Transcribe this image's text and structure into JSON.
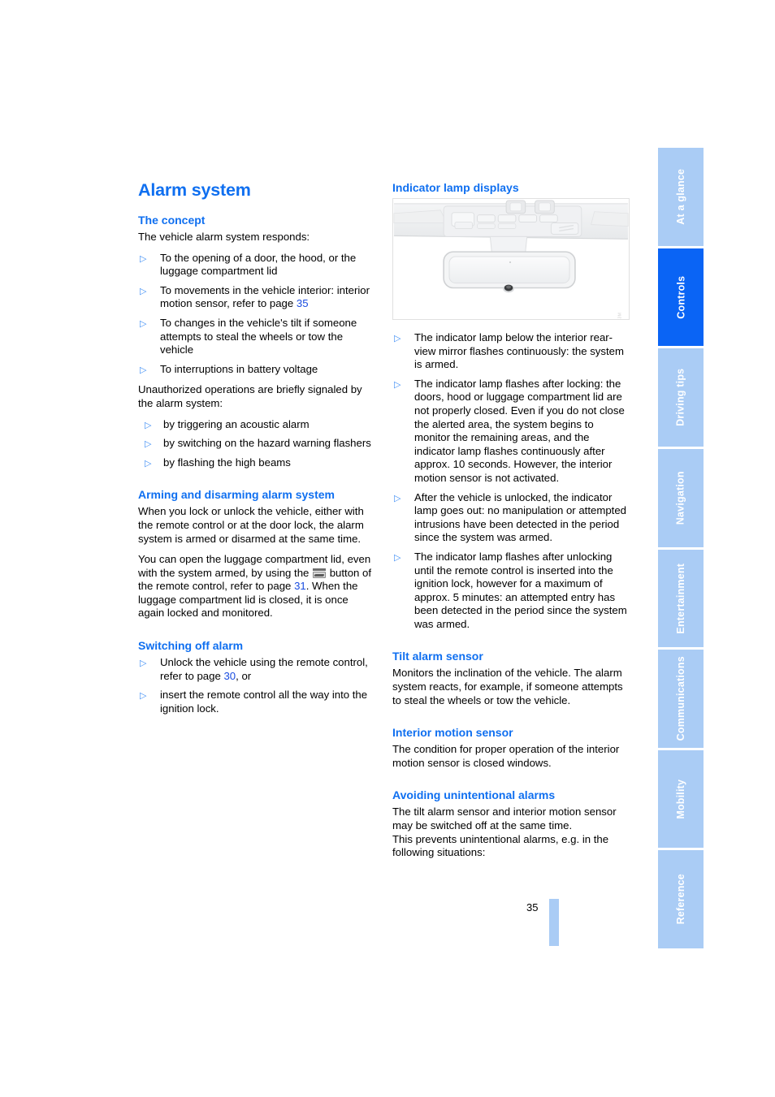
{
  "page": {
    "number": "35",
    "title": "Alarm system"
  },
  "left_column": {
    "section_concept": {
      "heading": "The concept",
      "intro": "The vehicle alarm system responds:",
      "bullets": [
        "To the opening of a door, the hood, or the luggage compartment lid",
        "To movements in the vehicle interior: interior motion sensor, refer to page ",
        "To changes in the vehicle's tilt if someone attempts to steal the wheels or tow the vehicle",
        "To interruptions in battery voltage"
      ],
      "bullet2_pageref": "35",
      "signal_intro": "Unauthorized operations are briefly signaled by the alarm system:",
      "signal_bullets": [
        "by triggering an acoustic alarm",
        "by switching on the hazard warning flashers",
        "by flashing the high beams"
      ]
    },
    "section_arming": {
      "heading": "Arming and disarming alarm system",
      "paragraph1": "When you lock or unlock the vehicle, either with the remote control or at the door lock, the alarm system is armed or disarmed at the same time.",
      "paragraph2_part1": "You can open the luggage compartment lid, even with the system armed, by using the ",
      "paragraph2_part2": " button of the remote control, refer to page ",
      "paragraph2_pageref": "31",
      "paragraph2_part3": ". When the luggage compartment lid is closed, it is once again locked and monitored.",
      "icon_name": "luggage-compartment-button-icon"
    },
    "section_switching_off": {
      "heading": "Switching off alarm",
      "bullets": [
        "Unlock the vehicle using the remote control, refer to page ",
        "insert the remote control all the way into the ignition lock."
      ],
      "bullet1_pageref": "30",
      "bullet1_suffix": ", or"
    }
  },
  "right_column": {
    "section_indicator": {
      "heading": "Indicator lamp displays",
      "figure_caption_code": "AC2N103M",
      "figure_alt": "Interior rear-view mirror with overhead console and indicator lamp",
      "bullets": [
        "The indicator lamp below the interior rear-view mirror flashes continuously: the system is armed.",
        "The indicator lamp flashes after locking: the doors, hood or luggage compartment lid are not properly closed. Even if you do not close the alerted area, the system begins to monitor the remaining areas, and the indicator lamp flashes continuously after approx. 10 seconds. However, the interior motion sensor is not activated.",
        "After the vehicle is unlocked, the indicator lamp goes out: no manipulation or attempted intrusions have been detected in the period since the system was armed.",
        "The indicator lamp flashes after unlocking until the remote control is inserted into the ignition lock, however for a maximum of approx. 5 minutes: an attempted entry has been detected in the period since the system was armed."
      ]
    },
    "section_tilt": {
      "heading": "Tilt alarm sensor",
      "paragraph": "Monitors the inclination of the vehicle. The alarm system reacts, for example, if someone attempts to steal the wheels or tow the vehicle."
    },
    "section_motion": {
      "heading": "Interior motion sensor",
      "paragraph": "The condition for proper operation of the interior motion sensor is closed windows."
    },
    "section_avoiding": {
      "heading": "Avoiding unintentional alarms",
      "paragraph1": "The tilt alarm sensor and interior motion sensor may be switched off at the same time.",
      "paragraph2": "This prevents unintentional alarms, e.g. in the following situations:"
    }
  },
  "sidebar": {
    "active": "Controls",
    "tabs": [
      {
        "label": "At a glance",
        "active": false
      },
      {
        "label": "Controls",
        "active": true
      },
      {
        "label": "Driving tips",
        "active": false
      },
      {
        "label": "Navigation",
        "active": false
      },
      {
        "label": "Entertainment",
        "active": false
      },
      {
        "label": "Communications",
        "active": false
      },
      {
        "label": "Mobility",
        "active": false
      },
      {
        "label": "Reference",
        "active": false
      }
    ]
  },
  "colors": {
    "heading_blue": "#0f6ff0",
    "tab_inactive": "#aaccf5",
    "tab_active": "#0a64f5",
    "bullet_blue": "#3f8ef5",
    "pageref_blue": "#1a4de0"
  }
}
